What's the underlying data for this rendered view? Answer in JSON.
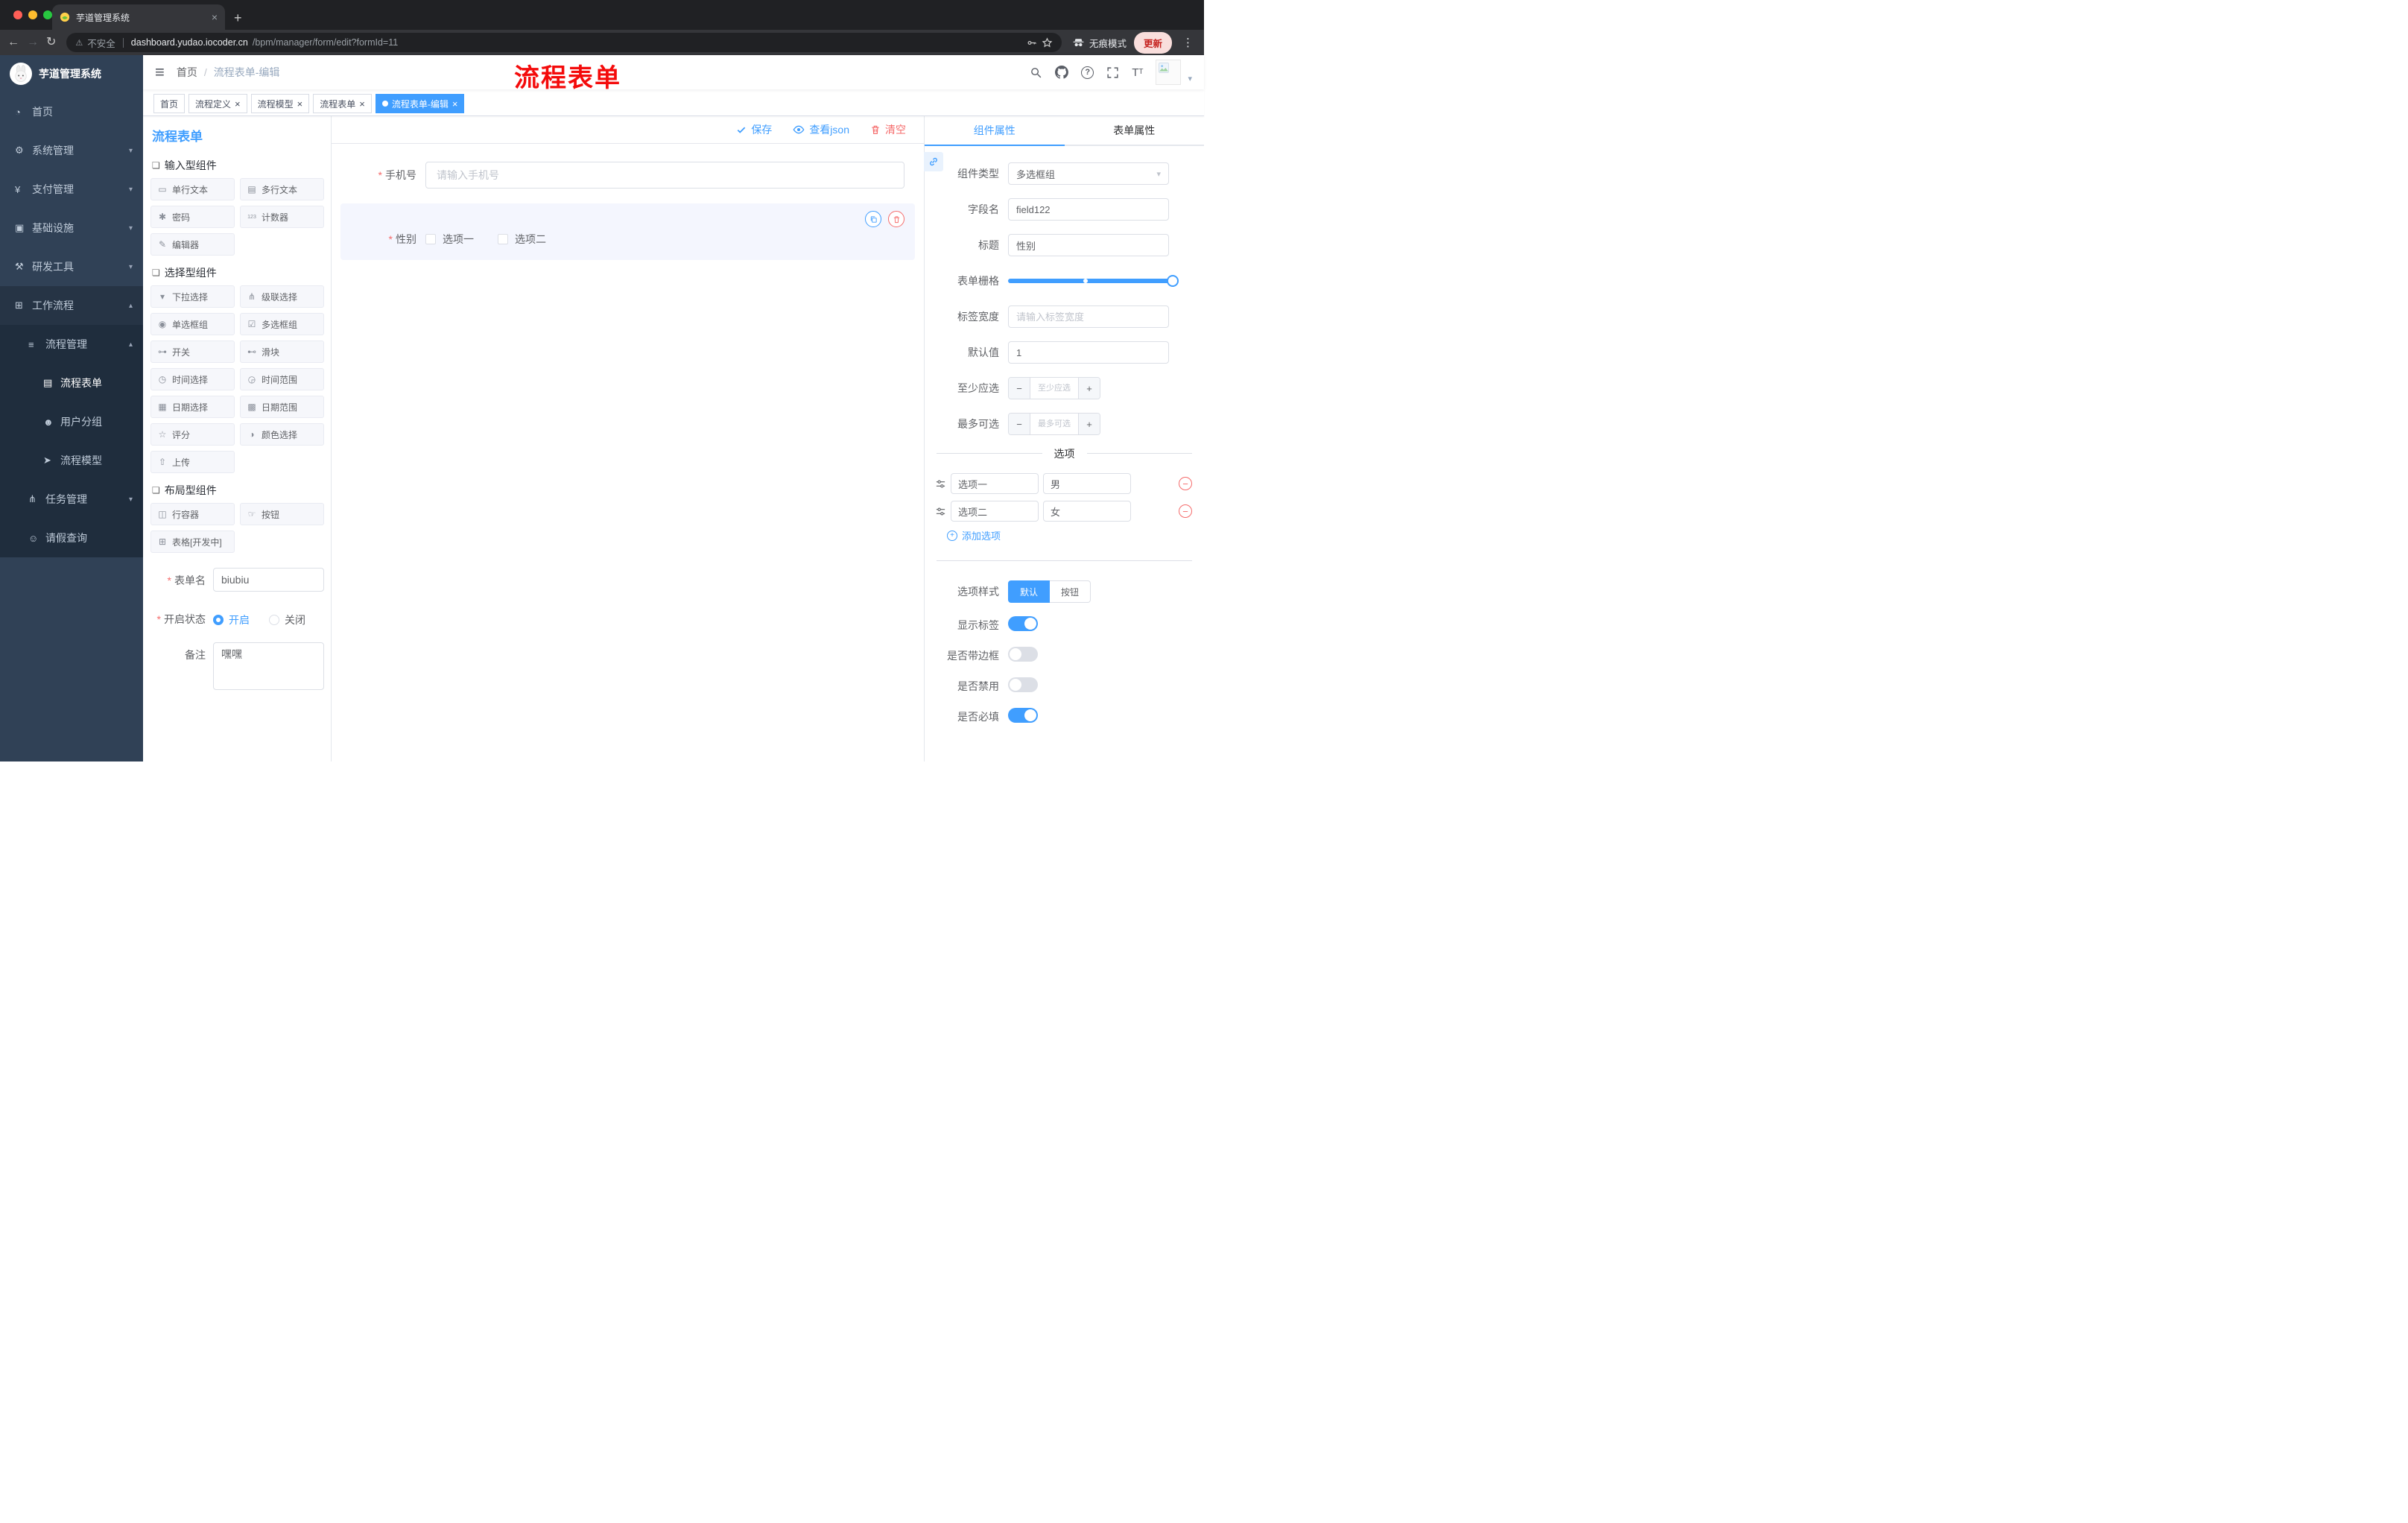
{
  "browser": {
    "tab_title": "芋道管理系统",
    "security_label": "不安全",
    "url_domain": "dashboard.yudao.iocoder.cn",
    "url_path": "/bpm/manager/form/edit?formId=11",
    "incognito_label": "无痕模式",
    "update_label": "更新"
  },
  "sidebar": {
    "brand": "芋道管理系统",
    "items": [
      {
        "id": "home",
        "label": "首页",
        "icon": "dashboard-icon",
        "level": 1
      },
      {
        "id": "system",
        "label": "系统管理",
        "icon": "gear-icon",
        "level": 1,
        "arrow": "down"
      },
      {
        "id": "payment",
        "label": "支付管理",
        "icon": "yen-icon",
        "level": 1,
        "arrow": "down"
      },
      {
        "id": "infra",
        "label": "基础设施",
        "icon": "monitor-icon",
        "level": 1,
        "arrow": "down"
      },
      {
        "id": "devtools",
        "label": "研发工具",
        "icon": "tools-icon",
        "level": 1,
        "arrow": "down"
      },
      {
        "id": "workflow",
        "label": "工作流程",
        "icon": "workflow-icon",
        "level": 1,
        "arrow": "up",
        "open": true
      },
      {
        "id": "process-manage",
        "label": "流程管理",
        "icon": "flow-list-icon",
        "level": 2,
        "arrow": "up",
        "open": true
      },
      {
        "id": "process-form",
        "label": "流程表单",
        "icon": "form-icon",
        "level": 3,
        "active": true
      },
      {
        "id": "user-group",
        "label": "用户分组",
        "icon": "user-group-icon",
        "level": 3
      },
      {
        "id": "process-model",
        "label": "流程模型",
        "icon": "model-icon",
        "level": 3
      },
      {
        "id": "task-manage",
        "label": "任务管理",
        "icon": "task-icon",
        "level": 2,
        "arrow": "down"
      },
      {
        "id": "leave-query",
        "label": "请假查询",
        "icon": "person-icon",
        "level": 2
      }
    ]
  },
  "header": {
    "breadcrumb_home": "首页",
    "breadcrumb_current": "流程表单-编辑",
    "annotation": "流程表单",
    "icons": [
      "search-icon",
      "github-icon",
      "help-icon",
      "fullscreen-icon",
      "font-size-icon",
      "avatar",
      "caret-down-icon"
    ]
  },
  "tags": [
    {
      "label": "首页",
      "closable": false,
      "active": false
    },
    {
      "label": "流程定义",
      "closable": true,
      "active": false
    },
    {
      "label": "流程模型",
      "closable": true,
      "active": false
    },
    {
      "label": "流程表单",
      "closable": true,
      "active": false
    },
    {
      "label": "流程表单-编辑",
      "closable": true,
      "active": true
    }
  ],
  "designer": {
    "title": "流程表单",
    "groups": [
      {
        "title": "输入型组件",
        "items": [
          {
            "id": "input",
            "label": "单行文本",
            "icon": "single-line-icon"
          },
          {
            "id": "textarea",
            "label": "多行文本",
            "icon": "multi-line-icon"
          },
          {
            "id": "password",
            "label": "密码",
            "icon": "password-icon"
          },
          {
            "id": "counter",
            "label": "计数器",
            "icon": "counter-icon"
          },
          {
            "id": "editor",
            "label": "编辑器",
            "icon": "editor-icon"
          }
        ]
      },
      {
        "title": "选择型组件",
        "items": [
          {
            "id": "select",
            "label": "下拉选择",
            "icon": "select-icon"
          },
          {
            "id": "cascader",
            "label": "级联选择",
            "icon": "cascader-icon"
          },
          {
            "id": "radio-group",
            "label": "单选框组",
            "icon": "radio-icon"
          },
          {
            "id": "checkbox-group",
            "label": "多选框组",
            "icon": "checkbox-icon"
          },
          {
            "id": "switch",
            "label": "开关",
            "icon": "switch-icon"
          },
          {
            "id": "slider",
            "label": "滑块",
            "icon": "slider-icon"
          },
          {
            "id": "time",
            "label": "时间选择",
            "icon": "time-icon"
          },
          {
            "id": "time-range",
            "label": "时间范围",
            "icon": "time-range-icon"
          },
          {
            "id": "date",
            "label": "日期选择",
            "icon": "date-icon"
          },
          {
            "id": "date-range",
            "label": "日期范围",
            "icon": "date-range-icon"
          },
          {
            "id": "rate",
            "label": "评分",
            "icon": "rate-icon"
          },
          {
            "id": "color",
            "label": "颜色选择",
            "icon": "color-icon"
          },
          {
            "id": "upload",
            "label": "上传",
            "icon": "upload-icon"
          }
        ]
      },
      {
        "title": "布局型组件",
        "items": [
          {
            "id": "row",
            "label": "行容器",
            "icon": "row-icon"
          },
          {
            "id": "button",
            "label": "按钮",
            "icon": "button-icon"
          },
          {
            "id": "table",
            "label": "表格[开发中]",
            "icon": "table-icon"
          }
        ]
      }
    ],
    "form": {
      "name_label": "表单名",
      "name_value": "biubiu",
      "status_label": "开启状态",
      "status_on": "开启",
      "status_off": "关闭",
      "status_value": "开启",
      "remark_label": "备注",
      "remark_value": "嘿嘿"
    }
  },
  "canvas": {
    "save_label": "保存",
    "view_json_label": "查看json",
    "clear_label": "清空",
    "phone": {
      "label": "手机号",
      "required": true,
      "placeholder": "请输入手机号"
    },
    "gender": {
      "label": "性别",
      "required": true,
      "options": [
        "选项一",
        "选项二"
      ],
      "selected": true
    }
  },
  "props": {
    "tab_component": "组件属性",
    "tab_form": "表单属性",
    "component_type_label": "组件类型",
    "component_type_value": "多选框组",
    "field_name_label": "字段名",
    "field_name_value": "field122",
    "title_label": "标题",
    "title_value": "性别",
    "grid_label": "表单栅格",
    "label_width_label": "标签宽度",
    "label_width_placeholder": "请输入标签宽度",
    "default_label": "默认值",
    "default_value": "1",
    "min_label": "至少应选",
    "min_placeholder": "至少应选",
    "max_label": "最多可选",
    "max_placeholder": "最多可选",
    "options_title": "选项",
    "options": [
      {
        "label": "选项一",
        "value": "男"
      },
      {
        "label": "选项二",
        "value": "女"
      }
    ],
    "add_option_label": "添加选项",
    "option_style_label": "选项样式",
    "option_style_choices": [
      "默认",
      "按钮"
    ],
    "option_style_selected": "默认",
    "switches": [
      {
        "label": "显示标签",
        "on": true
      },
      {
        "label": "是否带边框",
        "on": false
      },
      {
        "label": "是否禁用",
        "on": false
      },
      {
        "label": "是否必填",
        "on": true
      }
    ]
  },
  "colors": {
    "primary": "#409eff",
    "danger": "#f56c6c",
    "annotation_red": "#f40b0b",
    "sidebar_bg": "#304156",
    "sidebar_sub_bg": "#1f2d3d"
  }
}
